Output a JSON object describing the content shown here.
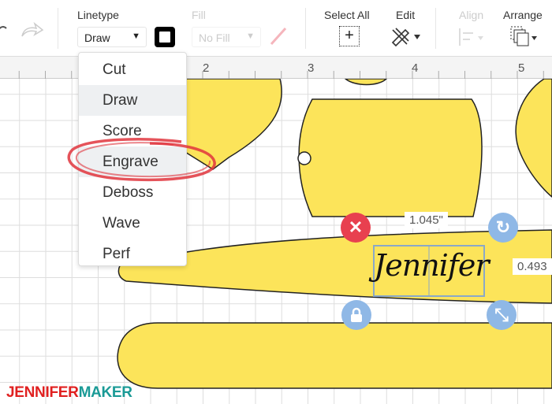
{
  "toolbar": {
    "linetype_label": "Linetype",
    "linetype_value": "Draw",
    "fill_label": "Fill",
    "fill_value": "No Fill",
    "select_all_label": "Select All",
    "edit_label": "Edit",
    "align_label": "Align",
    "arrange_label": "Arrange"
  },
  "ruler": {
    "ticks": [
      "2",
      "3",
      "4",
      "5"
    ]
  },
  "linetype_menu": {
    "items": [
      "Cut",
      "Draw",
      "Score",
      "Engrave",
      "Deboss",
      "Wave",
      "Perf"
    ],
    "selected": "Draw",
    "highlighted": "Engrave"
  },
  "selection": {
    "width": "1.045\"",
    "height": "0.493",
    "text": "Jennifer"
  },
  "colors": {
    "shape_fill": "#fce45a",
    "delete": "#e8404f",
    "handle": "#8fb8e6",
    "annotation": "#e0353d",
    "logo_red": "#e02020",
    "logo_teal": "#1a9a96"
  },
  "logo": {
    "part1": "JENNIFER",
    "part2": "MAKER"
  }
}
